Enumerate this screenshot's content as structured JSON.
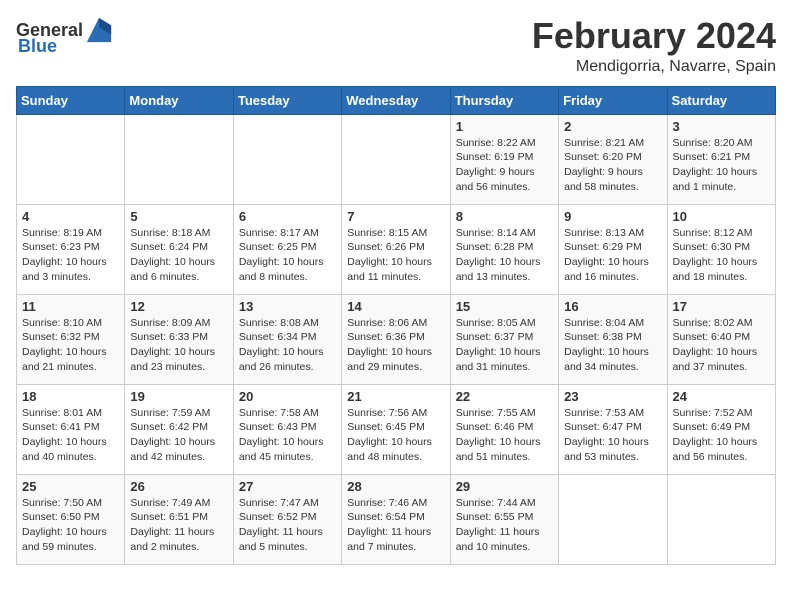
{
  "header": {
    "logo_general": "General",
    "logo_blue": "Blue",
    "month_title": "February 2024",
    "location": "Mendigorria, Navarre, Spain"
  },
  "days_of_week": [
    "Sunday",
    "Monday",
    "Tuesday",
    "Wednesday",
    "Thursday",
    "Friday",
    "Saturday"
  ],
  "weeks": [
    [
      {
        "day": "",
        "info": ""
      },
      {
        "day": "",
        "info": ""
      },
      {
        "day": "",
        "info": ""
      },
      {
        "day": "",
        "info": ""
      },
      {
        "day": "1",
        "info": "Sunrise: 8:22 AM\nSunset: 6:19 PM\nDaylight: 9 hours and 56 minutes."
      },
      {
        "day": "2",
        "info": "Sunrise: 8:21 AM\nSunset: 6:20 PM\nDaylight: 9 hours and 58 minutes."
      },
      {
        "day": "3",
        "info": "Sunrise: 8:20 AM\nSunset: 6:21 PM\nDaylight: 10 hours and 1 minute."
      }
    ],
    [
      {
        "day": "4",
        "info": "Sunrise: 8:19 AM\nSunset: 6:23 PM\nDaylight: 10 hours and 3 minutes."
      },
      {
        "day": "5",
        "info": "Sunrise: 8:18 AM\nSunset: 6:24 PM\nDaylight: 10 hours and 6 minutes."
      },
      {
        "day": "6",
        "info": "Sunrise: 8:17 AM\nSunset: 6:25 PM\nDaylight: 10 hours and 8 minutes."
      },
      {
        "day": "7",
        "info": "Sunrise: 8:15 AM\nSunset: 6:26 PM\nDaylight: 10 hours and 11 minutes."
      },
      {
        "day": "8",
        "info": "Sunrise: 8:14 AM\nSunset: 6:28 PM\nDaylight: 10 hours and 13 minutes."
      },
      {
        "day": "9",
        "info": "Sunrise: 8:13 AM\nSunset: 6:29 PM\nDaylight: 10 hours and 16 minutes."
      },
      {
        "day": "10",
        "info": "Sunrise: 8:12 AM\nSunset: 6:30 PM\nDaylight: 10 hours and 18 minutes."
      }
    ],
    [
      {
        "day": "11",
        "info": "Sunrise: 8:10 AM\nSunset: 6:32 PM\nDaylight: 10 hours and 21 minutes."
      },
      {
        "day": "12",
        "info": "Sunrise: 8:09 AM\nSunset: 6:33 PM\nDaylight: 10 hours and 23 minutes."
      },
      {
        "day": "13",
        "info": "Sunrise: 8:08 AM\nSunset: 6:34 PM\nDaylight: 10 hours and 26 minutes."
      },
      {
        "day": "14",
        "info": "Sunrise: 8:06 AM\nSunset: 6:36 PM\nDaylight: 10 hours and 29 minutes."
      },
      {
        "day": "15",
        "info": "Sunrise: 8:05 AM\nSunset: 6:37 PM\nDaylight: 10 hours and 31 minutes."
      },
      {
        "day": "16",
        "info": "Sunrise: 8:04 AM\nSunset: 6:38 PM\nDaylight: 10 hours and 34 minutes."
      },
      {
        "day": "17",
        "info": "Sunrise: 8:02 AM\nSunset: 6:40 PM\nDaylight: 10 hours and 37 minutes."
      }
    ],
    [
      {
        "day": "18",
        "info": "Sunrise: 8:01 AM\nSunset: 6:41 PM\nDaylight: 10 hours and 40 minutes."
      },
      {
        "day": "19",
        "info": "Sunrise: 7:59 AM\nSunset: 6:42 PM\nDaylight: 10 hours and 42 minutes."
      },
      {
        "day": "20",
        "info": "Sunrise: 7:58 AM\nSunset: 6:43 PM\nDaylight: 10 hours and 45 minutes."
      },
      {
        "day": "21",
        "info": "Sunrise: 7:56 AM\nSunset: 6:45 PM\nDaylight: 10 hours and 48 minutes."
      },
      {
        "day": "22",
        "info": "Sunrise: 7:55 AM\nSunset: 6:46 PM\nDaylight: 10 hours and 51 minutes."
      },
      {
        "day": "23",
        "info": "Sunrise: 7:53 AM\nSunset: 6:47 PM\nDaylight: 10 hours and 53 minutes."
      },
      {
        "day": "24",
        "info": "Sunrise: 7:52 AM\nSunset: 6:49 PM\nDaylight: 10 hours and 56 minutes."
      }
    ],
    [
      {
        "day": "25",
        "info": "Sunrise: 7:50 AM\nSunset: 6:50 PM\nDaylight: 10 hours and 59 minutes."
      },
      {
        "day": "26",
        "info": "Sunrise: 7:49 AM\nSunset: 6:51 PM\nDaylight: 11 hours and 2 minutes."
      },
      {
        "day": "27",
        "info": "Sunrise: 7:47 AM\nSunset: 6:52 PM\nDaylight: 11 hours and 5 minutes."
      },
      {
        "day": "28",
        "info": "Sunrise: 7:46 AM\nSunset: 6:54 PM\nDaylight: 11 hours and 7 minutes."
      },
      {
        "day": "29",
        "info": "Sunrise: 7:44 AM\nSunset: 6:55 PM\nDaylight: 11 hours and 10 minutes."
      },
      {
        "day": "",
        "info": ""
      },
      {
        "day": "",
        "info": ""
      }
    ]
  ]
}
